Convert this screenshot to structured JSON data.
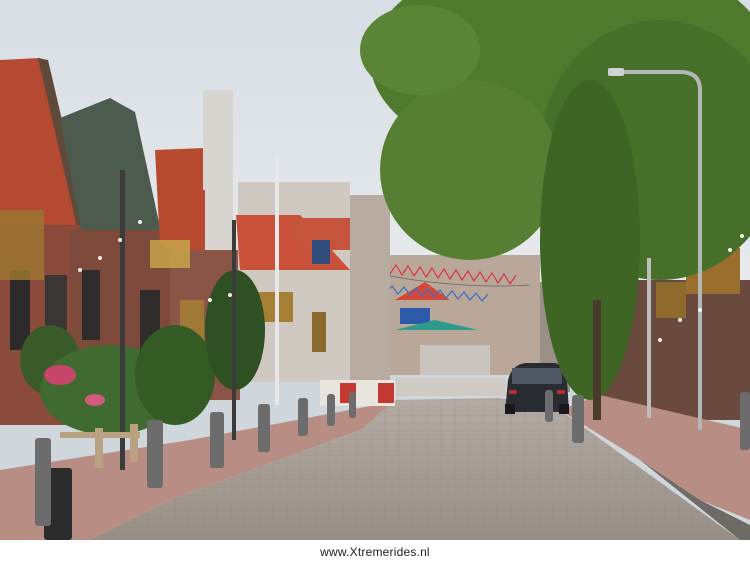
{
  "photo": {
    "scene": "village street",
    "colors": {
      "sky": "#dfe4ea",
      "road": "#a39b94",
      "sidewalk": "#b98f86",
      "brick": "#8a4a3c",
      "roof": "#b24a30",
      "tree": "#4d6e2a",
      "car": "#2a2c33"
    }
  },
  "watermark": {
    "text": "www.Xtremerides.nl"
  }
}
